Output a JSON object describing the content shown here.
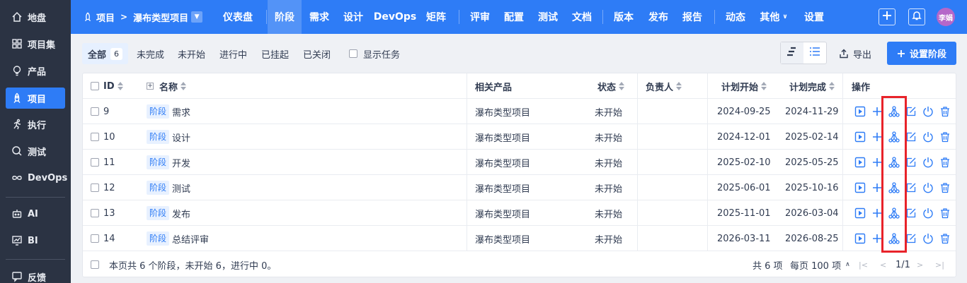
{
  "sidebar": {
    "items": [
      {
        "label": "地盘",
        "icon": "home-icon"
      },
      {
        "label": "项目集",
        "icon": "grid-icon"
      },
      {
        "label": "产品",
        "icon": "bulb-icon"
      },
      {
        "label": "项目",
        "icon": "rocket-icon",
        "active": true
      },
      {
        "label": "执行",
        "icon": "run-icon"
      },
      {
        "label": "测试",
        "icon": "search-icon"
      },
      {
        "label": "DevOps",
        "icon": "infinity-icon"
      },
      {
        "label": "AI",
        "icon": "robot-icon"
      },
      {
        "label": "BI",
        "icon": "chart-icon"
      },
      {
        "label": "反馈",
        "icon": "feedback-icon"
      }
    ]
  },
  "header": {
    "crumb_root": "项目",
    "crumb_current": "瀑布类型项目",
    "nav": [
      "仪表盘",
      "阶段",
      "需求",
      "设计",
      "DevOps",
      "矩阵",
      "评审",
      "配置",
      "测试",
      "文档",
      "版本",
      "发布",
      "报告",
      "动态",
      "其他",
      "设置"
    ],
    "active_nav": "阶段",
    "avatar_text": "李娟"
  },
  "filters": {
    "all_label": "全部",
    "all_count": "6",
    "items": [
      "未完成",
      "未开始",
      "进行中",
      "已挂起",
      "已关闭"
    ],
    "show_tasks": "显示任务",
    "export": "导出",
    "primary": "设置阶段"
  },
  "table": {
    "headers": {
      "id": "ID",
      "name": "名称",
      "product": "相关产品",
      "status": "状态",
      "owner": "负责人",
      "begin": "计划开始",
      "end": "计划完成",
      "actions": "操作"
    },
    "tag_label": "阶段",
    "rows": [
      {
        "id": "9",
        "name": "需求",
        "product": "瀑布类型项目",
        "status": "未开始",
        "owner": "",
        "begin": "2024-09-25",
        "end": "2024-11-29"
      },
      {
        "id": "10",
        "name": "设计",
        "product": "瀑布类型项目",
        "status": "未开始",
        "owner": "",
        "begin": "2024-12-01",
        "end": "2025-02-14"
      },
      {
        "id": "11",
        "name": "开发",
        "product": "瀑布类型项目",
        "status": "未开始",
        "owner": "",
        "begin": "2025-02-10",
        "end": "2025-05-25"
      },
      {
        "id": "12",
        "name": "测试",
        "product": "瀑布类型项目",
        "status": "未开始",
        "owner": "",
        "begin": "2025-06-01",
        "end": "2025-10-16"
      },
      {
        "id": "13",
        "name": "发布",
        "product": "瀑布类型项目",
        "status": "未开始",
        "owner": "",
        "begin": "2025-11-01",
        "end": "2026-03-04"
      },
      {
        "id": "14",
        "name": "总结评审",
        "product": "瀑布类型项目",
        "status": "未开始",
        "owner": "",
        "begin": "2026-03-11",
        "end": "2026-08-25"
      }
    ],
    "summary": "本页共 6 个阶段，未开始 6，进行中 0。",
    "total": "共 6 项",
    "per_page": "每页 100 项",
    "page": "1/1"
  },
  "colors": {
    "accent": "#2e7cf6",
    "sidebar": "#2b3343",
    "highlight": "#e8232a"
  }
}
